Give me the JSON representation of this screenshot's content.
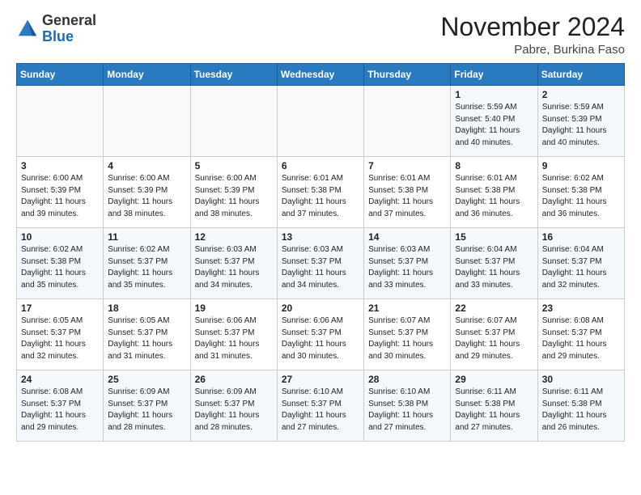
{
  "logo": {
    "general": "General",
    "blue": "Blue"
  },
  "header": {
    "month_title": "November 2024",
    "subtitle": "Pabre, Burkina Faso"
  },
  "days_of_week": [
    "Sunday",
    "Monday",
    "Tuesday",
    "Wednesday",
    "Thursday",
    "Friday",
    "Saturday"
  ],
  "weeks": [
    [
      {
        "day": "",
        "info": ""
      },
      {
        "day": "",
        "info": ""
      },
      {
        "day": "",
        "info": ""
      },
      {
        "day": "",
        "info": ""
      },
      {
        "day": "",
        "info": ""
      },
      {
        "day": "1",
        "info": "Sunrise: 5:59 AM\nSunset: 5:40 PM\nDaylight: 11 hours and 40 minutes."
      },
      {
        "day": "2",
        "info": "Sunrise: 5:59 AM\nSunset: 5:39 PM\nDaylight: 11 hours and 40 minutes."
      }
    ],
    [
      {
        "day": "3",
        "info": "Sunrise: 6:00 AM\nSunset: 5:39 PM\nDaylight: 11 hours and 39 minutes."
      },
      {
        "day": "4",
        "info": "Sunrise: 6:00 AM\nSunset: 5:39 PM\nDaylight: 11 hours and 38 minutes."
      },
      {
        "day": "5",
        "info": "Sunrise: 6:00 AM\nSunset: 5:39 PM\nDaylight: 11 hours and 38 minutes."
      },
      {
        "day": "6",
        "info": "Sunrise: 6:01 AM\nSunset: 5:38 PM\nDaylight: 11 hours and 37 minutes."
      },
      {
        "day": "7",
        "info": "Sunrise: 6:01 AM\nSunset: 5:38 PM\nDaylight: 11 hours and 37 minutes."
      },
      {
        "day": "8",
        "info": "Sunrise: 6:01 AM\nSunset: 5:38 PM\nDaylight: 11 hours and 36 minutes."
      },
      {
        "day": "9",
        "info": "Sunrise: 6:02 AM\nSunset: 5:38 PM\nDaylight: 11 hours and 36 minutes."
      }
    ],
    [
      {
        "day": "10",
        "info": "Sunrise: 6:02 AM\nSunset: 5:38 PM\nDaylight: 11 hours and 35 minutes."
      },
      {
        "day": "11",
        "info": "Sunrise: 6:02 AM\nSunset: 5:37 PM\nDaylight: 11 hours and 35 minutes."
      },
      {
        "day": "12",
        "info": "Sunrise: 6:03 AM\nSunset: 5:37 PM\nDaylight: 11 hours and 34 minutes."
      },
      {
        "day": "13",
        "info": "Sunrise: 6:03 AM\nSunset: 5:37 PM\nDaylight: 11 hours and 34 minutes."
      },
      {
        "day": "14",
        "info": "Sunrise: 6:03 AM\nSunset: 5:37 PM\nDaylight: 11 hours and 33 minutes."
      },
      {
        "day": "15",
        "info": "Sunrise: 6:04 AM\nSunset: 5:37 PM\nDaylight: 11 hours and 33 minutes."
      },
      {
        "day": "16",
        "info": "Sunrise: 6:04 AM\nSunset: 5:37 PM\nDaylight: 11 hours and 32 minutes."
      }
    ],
    [
      {
        "day": "17",
        "info": "Sunrise: 6:05 AM\nSunset: 5:37 PM\nDaylight: 11 hours and 32 minutes."
      },
      {
        "day": "18",
        "info": "Sunrise: 6:05 AM\nSunset: 5:37 PM\nDaylight: 11 hours and 31 minutes."
      },
      {
        "day": "19",
        "info": "Sunrise: 6:06 AM\nSunset: 5:37 PM\nDaylight: 11 hours and 31 minutes."
      },
      {
        "day": "20",
        "info": "Sunrise: 6:06 AM\nSunset: 5:37 PM\nDaylight: 11 hours and 30 minutes."
      },
      {
        "day": "21",
        "info": "Sunrise: 6:07 AM\nSunset: 5:37 PM\nDaylight: 11 hours and 30 minutes."
      },
      {
        "day": "22",
        "info": "Sunrise: 6:07 AM\nSunset: 5:37 PM\nDaylight: 11 hours and 29 minutes."
      },
      {
        "day": "23",
        "info": "Sunrise: 6:08 AM\nSunset: 5:37 PM\nDaylight: 11 hours and 29 minutes."
      }
    ],
    [
      {
        "day": "24",
        "info": "Sunrise: 6:08 AM\nSunset: 5:37 PM\nDaylight: 11 hours and 29 minutes."
      },
      {
        "day": "25",
        "info": "Sunrise: 6:09 AM\nSunset: 5:37 PM\nDaylight: 11 hours and 28 minutes."
      },
      {
        "day": "26",
        "info": "Sunrise: 6:09 AM\nSunset: 5:37 PM\nDaylight: 11 hours and 28 minutes."
      },
      {
        "day": "27",
        "info": "Sunrise: 6:10 AM\nSunset: 5:37 PM\nDaylight: 11 hours and 27 minutes."
      },
      {
        "day": "28",
        "info": "Sunrise: 6:10 AM\nSunset: 5:38 PM\nDaylight: 11 hours and 27 minutes."
      },
      {
        "day": "29",
        "info": "Sunrise: 6:11 AM\nSunset: 5:38 PM\nDaylight: 11 hours and 27 minutes."
      },
      {
        "day": "30",
        "info": "Sunrise: 6:11 AM\nSunset: 5:38 PM\nDaylight: 11 hours and 26 minutes."
      }
    ]
  ]
}
